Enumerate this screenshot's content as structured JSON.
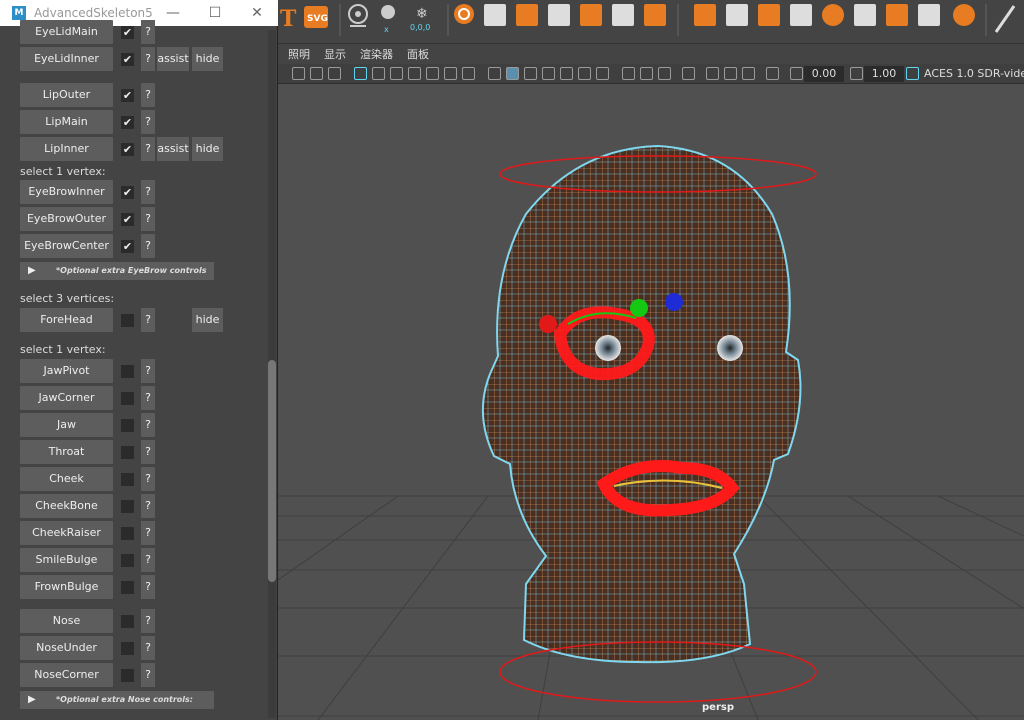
{
  "maya": {
    "menu": [
      "照明",
      "显示",
      "渲染器",
      "面板"
    ],
    "viewport": {
      "exposure_value": "0.00",
      "gamma_value": "1.00",
      "color_space": "ACES 1.0 SDR-vide",
      "camera": "persp"
    },
    "toolbar_icons": [
      "type-icon",
      "svg-icon",
      "center-pivot-icon",
      "snowflake-icon",
      "sphere-icon",
      "cube-icon"
    ]
  },
  "window": {
    "title": "AdvancedSkeleton5",
    "logo": "M"
  },
  "panel": {
    "rows": [
      {
        "label": "EyeLidMain",
        "checked": true,
        "q": "?"
      },
      {
        "label": "EyeLidInner",
        "checked": true,
        "q": "?",
        "assist": "assist",
        "hide": "hide"
      },
      {
        "label": "LipOuter",
        "checked": true,
        "q": "?"
      },
      {
        "label": "LipMain",
        "checked": true,
        "q": "?"
      },
      {
        "label": "LipInner",
        "checked": true,
        "q": "?",
        "assist": "assist",
        "hide": "hide"
      },
      {
        "label": "EyeBrowInner",
        "checked": true,
        "q": "?"
      },
      {
        "label": "EyeBrowOuter",
        "checked": true,
        "q": "?"
      },
      {
        "label": "EyeBrowCenter",
        "checked": true,
        "q": "?"
      },
      {
        "label": "ForeHead",
        "checked": false,
        "q": "?",
        "hide": "hide"
      },
      {
        "label": "JawPivot",
        "checked": false,
        "q": "?"
      },
      {
        "label": "JawCorner",
        "checked": false,
        "q": "?"
      },
      {
        "label": "Jaw",
        "checked": false,
        "q": "?"
      },
      {
        "label": "Throat",
        "checked": false,
        "q": "?"
      },
      {
        "label": "Cheek",
        "checked": false,
        "q": "?"
      },
      {
        "label": "CheekBone",
        "checked": false,
        "q": "?"
      },
      {
        "label": "CheekRaiser",
        "checked": false,
        "q": "?"
      },
      {
        "label": "SmileBulge",
        "checked": false,
        "q": "?"
      },
      {
        "label": "FrownBulge",
        "checked": false,
        "q": "?"
      },
      {
        "label": "Nose",
        "checked": false,
        "q": "?"
      },
      {
        "label": "NoseUnder",
        "checked": false,
        "q": "?"
      },
      {
        "label": "NoseCorner",
        "checked": false,
        "q": "?"
      }
    ],
    "section_labels": {
      "select1_eyebrow": "select 1 vertex:",
      "select3": "select 3 vertices:",
      "select1_jaw": "select 1 vertex:"
    },
    "optional_eyebrow": "*Optional extra EyeBrow controls",
    "optional_nose": "*Optional extra Nose controls:",
    "checkmark": "✔"
  },
  "colors": {
    "wire": "#5fd6f0",
    "skin": "#5a3a2a",
    "selection_red": "#ff1a1a",
    "guide_red": "#e11919",
    "guide_green": "#14c814",
    "guide_blue": "#1f2cd6"
  }
}
